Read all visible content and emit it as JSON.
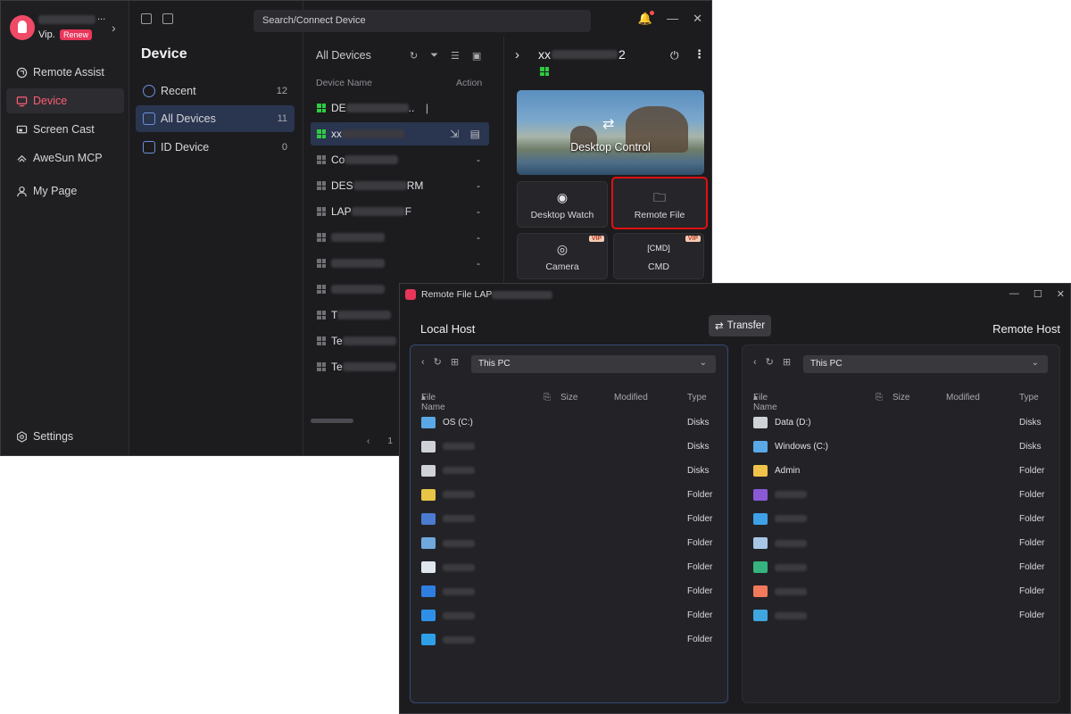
{
  "main_window": {
    "user": {
      "vip_label": "Vip.",
      "renew_label": "Renew",
      "more": "..."
    },
    "nav": [
      {
        "label": "Remote Assist",
        "icon": "remote-assist-icon"
      },
      {
        "label": "Device",
        "icon": "device-icon"
      },
      {
        "label": "Screen Cast",
        "icon": "screen-cast-icon"
      },
      {
        "label": "AweSun MCP",
        "icon": "mcp-icon"
      },
      {
        "label": "My Page",
        "icon": "person-icon"
      }
    ],
    "settings_label": "Settings",
    "search_placeholder": "Search/Connect Device",
    "device_panel": {
      "title": "Device",
      "items": [
        {
          "label": "Recent",
          "count": "12"
        },
        {
          "label": "All Devices",
          "count": "11"
        },
        {
          "label": "ID Device",
          "count": "0"
        }
      ]
    },
    "list": {
      "title": "All Devices",
      "col_name": "Device Name",
      "col_action": "Action",
      "rows": [
        {
          "name_visible": "DE",
          "suffix": "..",
          "action": "",
          "online": true
        },
        {
          "name_visible": "xx",
          "suffix": "",
          "action": "",
          "online": true
        },
        {
          "name_visible": "Co",
          "suffix": "",
          "action": "-",
          "online": false
        },
        {
          "name_visible": "DES",
          "suffix": "RM",
          "action": "-",
          "online": false
        },
        {
          "name_visible": "LAP",
          "suffix": "F",
          "action": "-",
          "online": false
        },
        {
          "name_visible": "",
          "suffix": "",
          "action": "-",
          "online": false
        },
        {
          "name_visible": "",
          "suffix": "",
          "action": "-",
          "online": false
        },
        {
          "name_visible": "",
          "suffix": "",
          "action": "",
          "online": false
        },
        {
          "name_visible": "T",
          "suffix": "",
          "action": "",
          "online": false
        },
        {
          "name_visible": "Te",
          "suffix": "",
          "action": "",
          "online": false
        },
        {
          "name_visible": "Te",
          "suffix": "",
          "action": "",
          "online": false
        }
      ],
      "pager": {
        "prev": "‹",
        "page": "1"
      }
    },
    "detail": {
      "name_prefix": "xx",
      "name_suffix": "2",
      "desktop_control": "Desktop Control",
      "tiles": [
        {
          "label": "Desktop Watch",
          "icon": "eye-icon",
          "vip": false
        },
        {
          "label": "Remote File",
          "icon": "folder-transfer-icon",
          "vip": false
        },
        {
          "label": "Camera",
          "icon": "camera-icon",
          "vip": true
        },
        {
          "label": "CMD",
          "icon": "cmd-icon",
          "vip": true
        }
      ],
      "vip_badge": "VIP"
    }
  },
  "remote_file_window": {
    "title": "Remote File LAP",
    "transfer_label": "Transfer",
    "local_title": "Local Host",
    "remote_title": "Remote Host",
    "columns": {
      "name": "File Name",
      "size": "Size",
      "modified": "Modified",
      "type": "Type"
    },
    "path": "This PC",
    "local_files": [
      {
        "name": "OS (C:)",
        "type": "Disks",
        "icon": "drive-icon",
        "color": "#5aa9e6"
      },
      {
        "name": "",
        "type": "Disks",
        "icon": "drive-icon",
        "color": "#cfd2d6"
      },
      {
        "name": "",
        "type": "Disks",
        "icon": "drive-icon",
        "color": "#cfd2d6"
      },
      {
        "name": "",
        "type": "Folder",
        "icon": "folder-icon",
        "color": "#e8c547"
      },
      {
        "name": "",
        "type": "Folder",
        "icon": "video-icon",
        "color": "#4a7bd0"
      },
      {
        "name": "",
        "type": "Folder",
        "icon": "image-icon",
        "color": "#6fa8dc"
      },
      {
        "name": "",
        "type": "Folder",
        "icon": "document-icon",
        "color": "#dfe6ee"
      },
      {
        "name": "",
        "type": "Folder",
        "icon": "download-icon",
        "color": "#2f7fe0"
      },
      {
        "name": "",
        "type": "Folder",
        "icon": "music-icon",
        "color": "#2f8fe8"
      },
      {
        "name": "",
        "type": "Folder",
        "icon": "desktop-icon",
        "color": "#2f9fe8"
      }
    ],
    "remote_files": [
      {
        "name": "Data (D:)",
        "type": "Disks",
        "icon": "drive-icon",
        "color": "#cfd2d6"
      },
      {
        "name": "Windows (C:)",
        "type": "Disks",
        "icon": "drive-icon",
        "color": "#5aa9e6"
      },
      {
        "name": "Admin",
        "type": "Folder",
        "icon": "folder-icon",
        "color": "#f0c24a"
      },
      {
        "name": "",
        "type": "Folder",
        "icon": "video-icon",
        "color": "#8a5ad6"
      },
      {
        "name": "",
        "type": "Folder",
        "icon": "image-icon",
        "color": "#3fa0e8"
      },
      {
        "name": "",
        "type": "Folder",
        "icon": "document-icon",
        "color": "#a8c6e6"
      },
      {
        "name": "",
        "type": "Folder",
        "icon": "download-icon",
        "color": "#36b37e"
      },
      {
        "name": "",
        "type": "Folder",
        "icon": "music-icon",
        "color": "#f07a5a"
      },
      {
        "name": "",
        "type": "Folder",
        "icon": "desktop-icon",
        "color": "#3fa6e0"
      }
    ]
  }
}
